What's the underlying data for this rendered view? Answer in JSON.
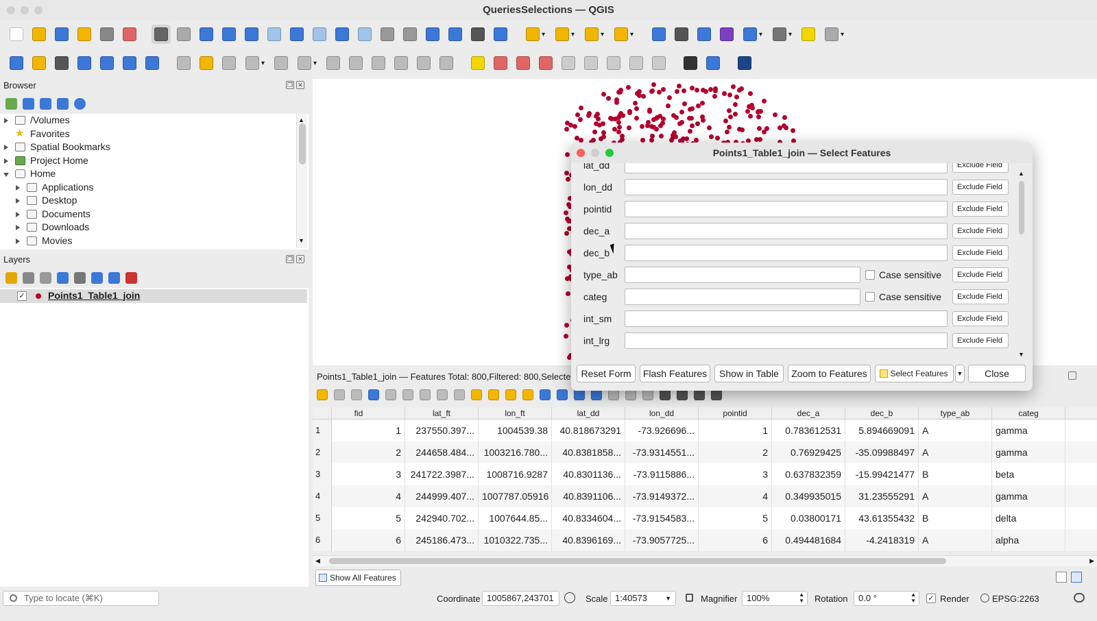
{
  "window": {
    "title": "QueriesSelections — QGIS"
  },
  "browser": {
    "title": "Browser",
    "items": [
      {
        "label": "/Volumes"
      },
      {
        "label": "Favorites"
      },
      {
        "label": "Spatial Bookmarks"
      },
      {
        "label": "Project Home"
      },
      {
        "label": "Home"
      },
      {
        "label": "Applications"
      },
      {
        "label": "Desktop"
      },
      {
        "label": "Documents"
      },
      {
        "label": "Downloads"
      },
      {
        "label": "Movies"
      }
    ]
  },
  "layers": {
    "title": "Layers",
    "items": [
      {
        "label": "Points1_Table1_join",
        "checked": true,
        "color": "#b3002d"
      }
    ]
  },
  "dialog": {
    "title": "Points1_Table1_join — Select Features",
    "fields": [
      {
        "label": "lat_dd",
        "value": "",
        "exclude": "Exclude Field"
      },
      {
        "label": "lon_dd",
        "value": "",
        "exclude": "Exclude Field"
      },
      {
        "label": "pointid",
        "value": "",
        "exclude": "Exclude Field"
      },
      {
        "label": "dec_a",
        "value": "",
        "exclude": "Exclude Field"
      },
      {
        "label": "dec_b",
        "value": "",
        "exclude": "Exclude Field"
      },
      {
        "label": "type_ab",
        "value": "",
        "case_label": "Case sensitive",
        "exclude": "Exclude Field"
      },
      {
        "label": "categ",
        "value": "",
        "case_label": "Case sensitive",
        "exclude": "Exclude Field"
      },
      {
        "label": "int_sm",
        "value": "",
        "exclude": "Exclude Field"
      },
      {
        "label": "int_lrg",
        "value": "",
        "exclude": "Exclude Field"
      }
    ],
    "buttons": {
      "reset": "Reset Form",
      "flash": "Flash Features",
      "show_table": "Show in Table",
      "zoom": "Zoom to Features",
      "select": "Select Features",
      "close": "Close"
    }
  },
  "attribute_table": {
    "status": "Points1_Table1_join — Features Total: 800,Filtered: 800,Selected:",
    "columns": [
      "fid",
      "lat_ft",
      "lon_ft",
      "lat_dd",
      "lon_dd",
      "pointid",
      "dec_a",
      "dec_b",
      "type_ab",
      "categ"
    ],
    "rows": [
      {
        "n": "1",
        "cells": [
          "1",
          "237550.397...",
          "1004539.38",
          "40.818673291",
          "-73.926696...",
          "1",
          "0.783612531",
          "5.894669091",
          "A",
          "gamma"
        ]
      },
      {
        "n": "2",
        "cells": [
          "2",
          "244658.484...",
          "1003216.780...",
          "40.8381858...",
          "-73.9314551...",
          "2",
          "0.76929425",
          "-35.09988497",
          "A",
          "gamma"
        ]
      },
      {
        "n": "3",
        "cells": [
          "3",
          "241722.3987...",
          "1008716.9287",
          "40.8301136...",
          "-73.9115886...",
          "3",
          "0.637832359",
          "-15.99421477",
          "B",
          "beta"
        ]
      },
      {
        "n": "4",
        "cells": [
          "4",
          "244999.407...",
          "1007787.05916",
          "40.8391106...",
          "-73.9149372...",
          "4",
          "0.349935015",
          "31.23555291",
          "A",
          "gamma"
        ]
      },
      {
        "n": "5",
        "cells": [
          "5",
          "242940.702...",
          "1007644.85...",
          "40.8334604...",
          "-73.9154583...",
          "5",
          "0.03800171",
          "43.61355432",
          "B",
          "delta"
        ]
      },
      {
        "n": "6",
        "cells": [
          "6",
          "245186.473...",
          "1010322.735...",
          "40.8396169...",
          "-73.9057725...",
          "6",
          "0.494481684",
          "-4.2418319",
          "A",
          "alpha"
        ]
      }
    ],
    "show_all": "Show All Features"
  },
  "statusbar": {
    "locate_placeholder": "Type to locate (⌘K)",
    "coordinate_label": "Coordinate",
    "coordinate": "1005867,243701",
    "scale_label": "Scale",
    "scale": "1:40573",
    "magnifier_label": "Magnifier",
    "magnifier": "100%",
    "rotation_label": "Rotation",
    "rotation": "0.0 °",
    "render_label": "Render",
    "crs": "EPSG:2263"
  }
}
